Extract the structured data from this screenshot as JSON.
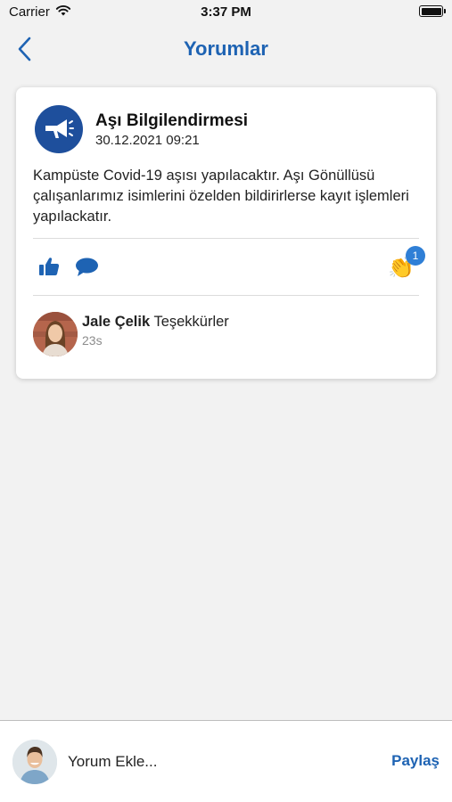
{
  "status_bar": {
    "carrier": "Carrier",
    "time": "3:37 PM",
    "battery_level": 1.0
  },
  "nav": {
    "title": "Yorumlar",
    "back_icon": "chevron-left-icon"
  },
  "post": {
    "avatar_icon": "megaphone-icon",
    "title": "Aşı Bilgilendirmesi",
    "date": "30.12.2021 09:21",
    "body": "Kampüste Covid-19 aşısı yapılacaktır. Aşı Gönüllüsü çalışanlarımız isimlerini özelden bildirirlerse kayıt işlemleri yapılackatır.",
    "actions": {
      "like_icon": "thumbs-up-icon",
      "comment_icon": "chat-bubble-icon",
      "clap_icon": "clapping-hands-icon",
      "clap_glyph": "👏",
      "clap_count": "1"
    }
  },
  "comments": [
    {
      "author": "Jale Çelik",
      "text": "Teşekkürler",
      "time": "23s"
    }
  ],
  "composer": {
    "placeholder": "Yorum Ekle...",
    "share_label": "Paylaş"
  },
  "colors": {
    "accent": "#1e63b3",
    "post_avatar_bg": "#1e4f9c",
    "badge": "#2f7fd6",
    "background": "#f2f2f2"
  }
}
